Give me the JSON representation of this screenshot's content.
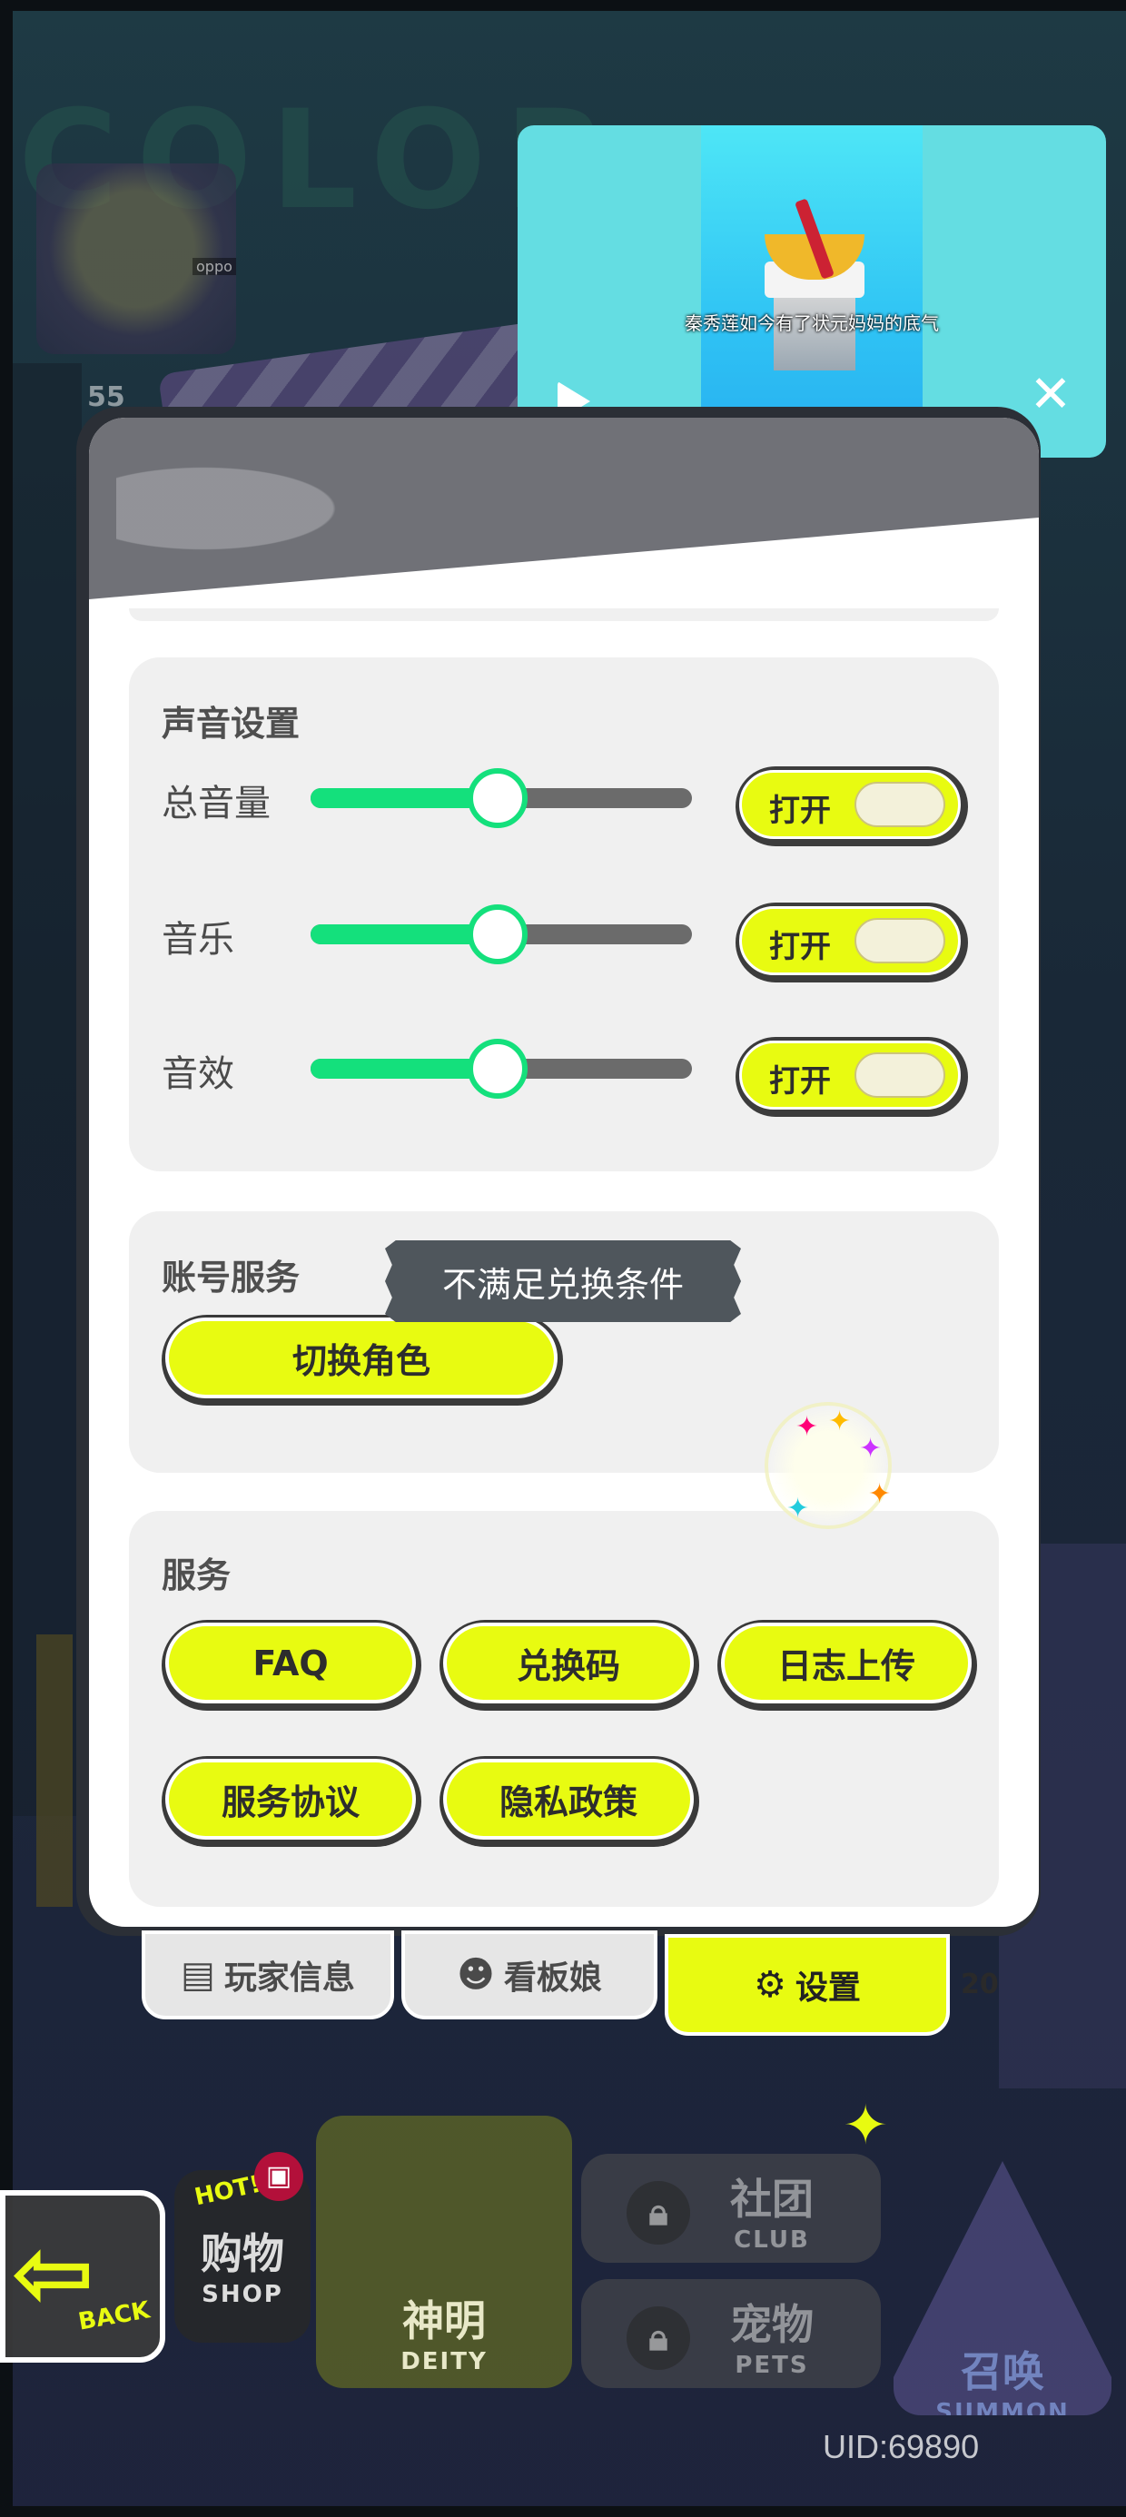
{
  "video_ad": {
    "caption": "秦秀莲如今有了状元妈妈的底气",
    "play_icon": "play-icon",
    "close_icon": "close-icon",
    "close_glyph": "✕"
  },
  "settings": {
    "sound": {
      "title": "声音设置",
      "rows": [
        {
          "label": "总音量",
          "value_percent": 49,
          "toggle_label": "打开"
        },
        {
          "label": "音乐",
          "value_percent": 49,
          "toggle_label": "打开"
        },
        {
          "label": "音效",
          "value_percent": 49,
          "toggle_label": "打开"
        }
      ]
    },
    "account": {
      "title": "账号服务",
      "switch_role": "切换角色",
      "tooltip": "不满足兑换条件"
    },
    "service": {
      "title": "服务",
      "buttons": [
        "FAQ",
        "兑换码",
        "日志上传",
        "服务协议",
        "隐私政策"
      ]
    }
  },
  "tabs": {
    "player_info": "玩家信息",
    "mascot": "看板娘",
    "settings": "设置",
    "badge_number": "20",
    "player_info_icon": "profile-card-icon",
    "mascot_icon": "person-icon",
    "settings_icon": "gear-icon"
  },
  "bottom_menu": {
    "back": "BACK",
    "hot": "HOT!",
    "shop_zh": "购物",
    "shop_en": "SHOP",
    "deity_zh": "神明",
    "deity_en": "DEITY",
    "club_zh": "社团",
    "club_en": "CLUB",
    "pets_zh": "宠物",
    "pets_en": "PETS",
    "summon_zh": "召唤",
    "summon_en": "SUMMON"
  },
  "background": {
    "avatar_tag": "oppo",
    "counter": "55"
  },
  "uid": "UID:69890",
  "colors": {
    "accent_yellow": "#e8fb11",
    "slider_green": "#14e07c",
    "panel_gray": "#f0f0f0"
  }
}
